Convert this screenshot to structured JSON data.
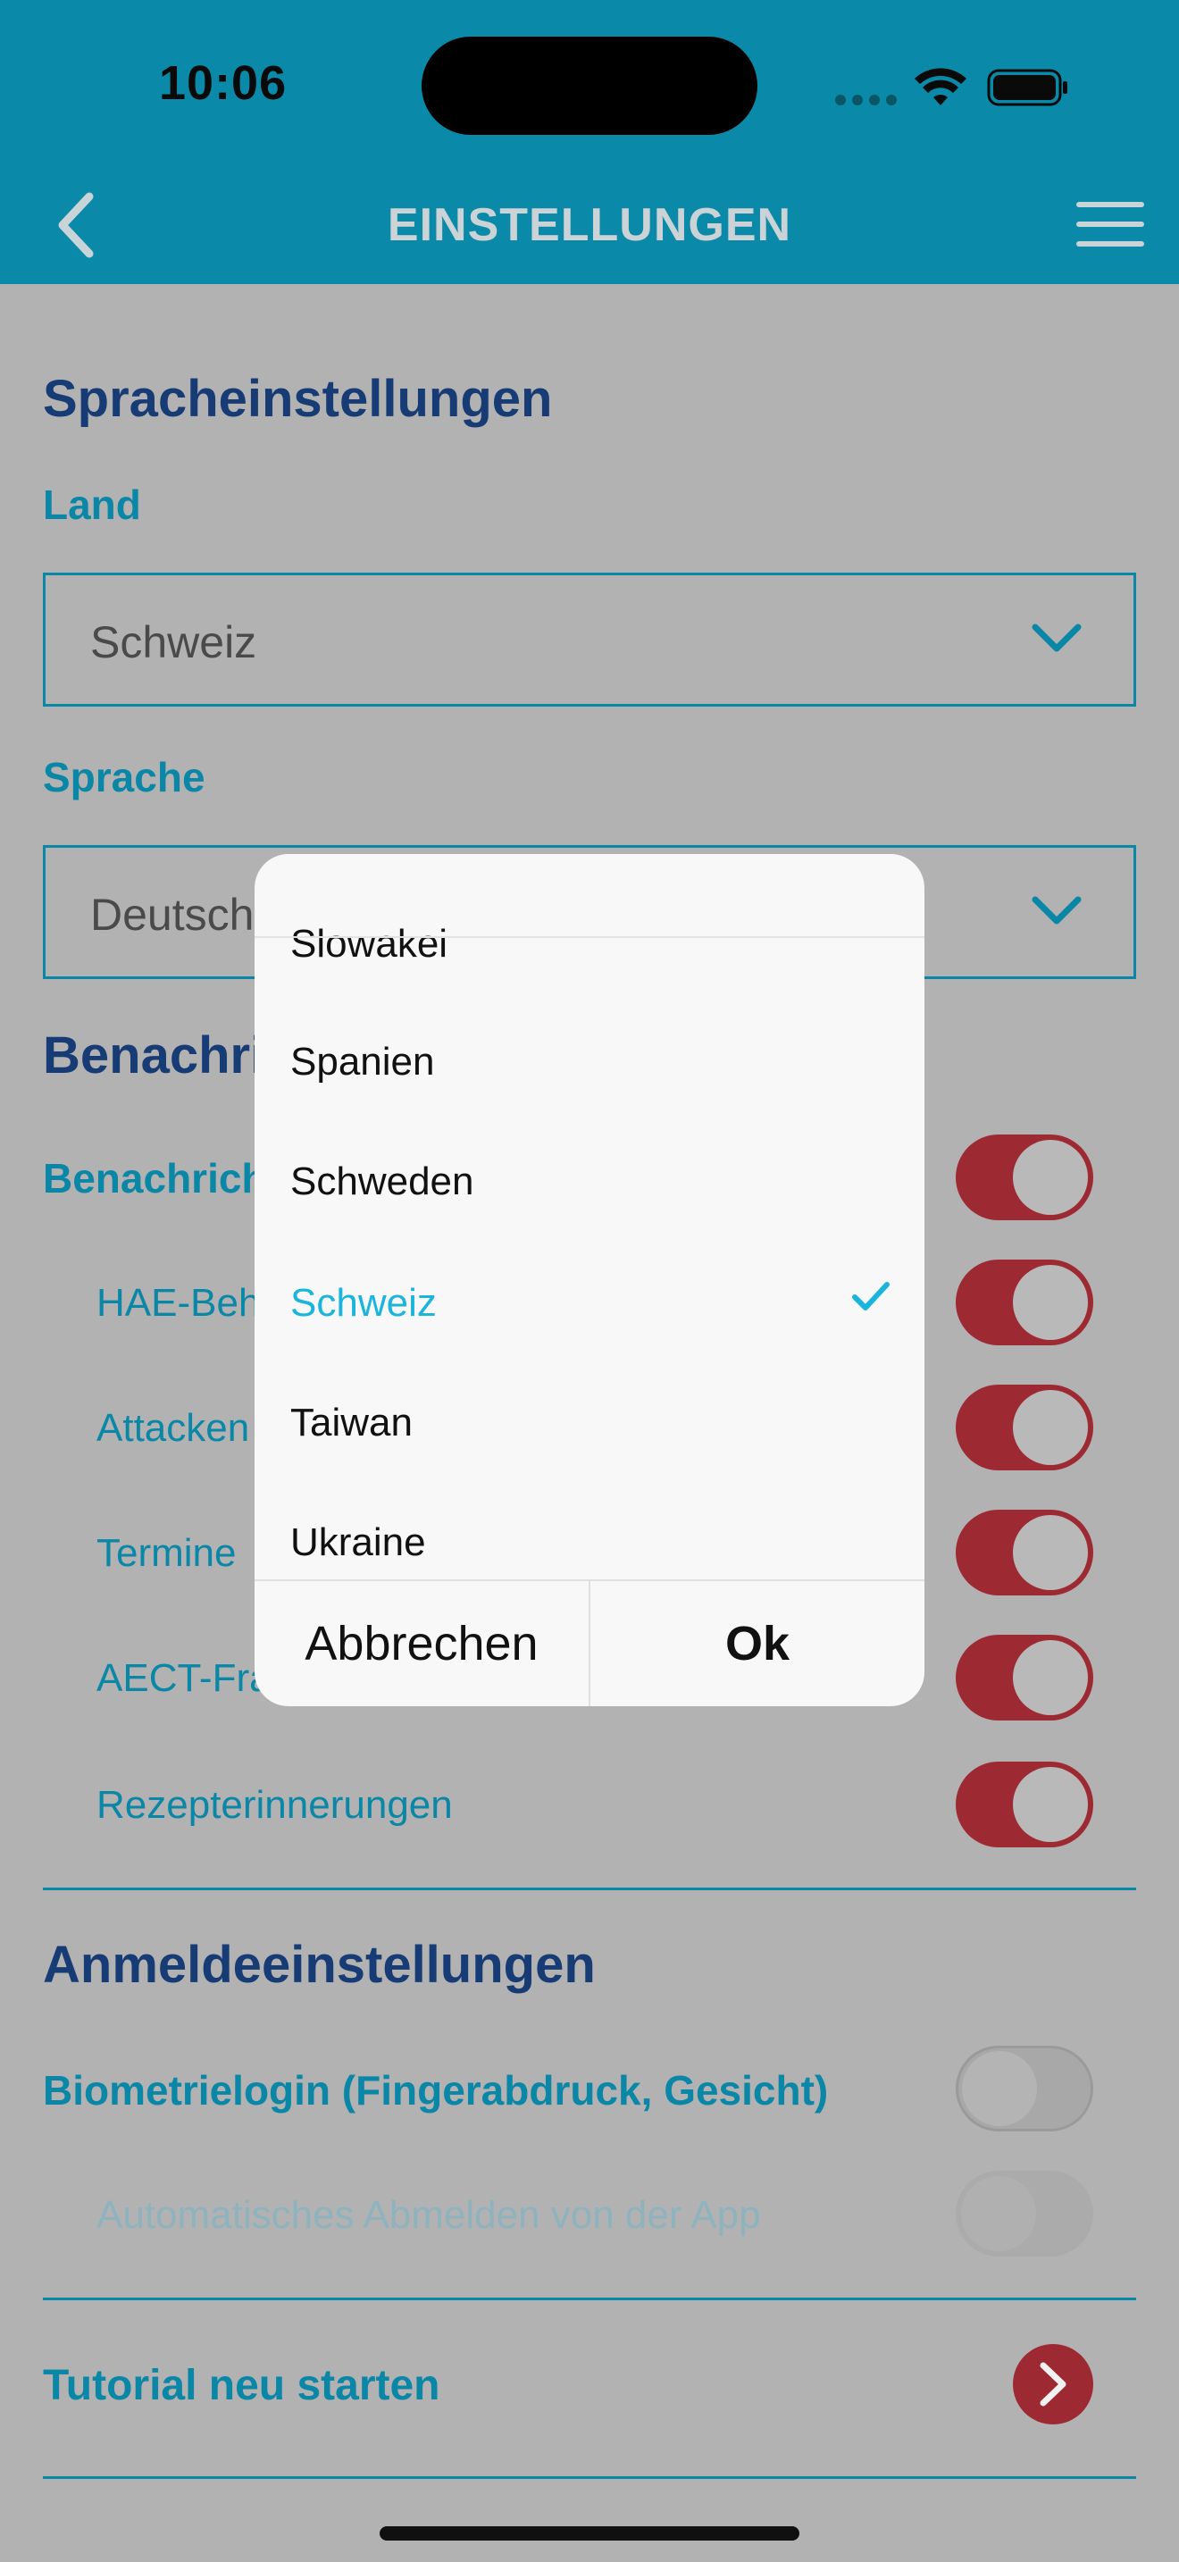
{
  "status_bar": {
    "time": "10:06"
  },
  "header": {
    "title": "EINSTELLUNGEN"
  },
  "language_settings": {
    "title": "Spracheinstellungen",
    "country_label": "Land",
    "country_value": "Schweiz",
    "language_label": "Sprache",
    "language_value": "Deutsch"
  },
  "notifications": {
    "title": "Benachrichtigungen",
    "main_label": "Benachrichtigungen",
    "items": [
      {
        "label": "HAE-Behandlungen",
        "on": true
      },
      {
        "label": "Attacken",
        "on": true
      },
      {
        "label": "Termine",
        "on": true
      },
      {
        "label": "AECT-Fragebogen",
        "on": true
      },
      {
        "label": "Rezepterinnerungen",
        "on": true
      }
    ]
  },
  "login_settings": {
    "title": "Anmeldeeinstellungen",
    "biometric_label": "Biometrielogin (Fingerabdruck, Gesicht)",
    "biometric_on": false,
    "auto_logout_label": "Automatisches Abmelden von der App",
    "auto_logout_on": false
  },
  "tutorial": {
    "label": "Tutorial neu starten"
  },
  "picker": {
    "items": [
      "Slowakei",
      "Spanien",
      "Schweden",
      "Schweiz",
      "Taiwan",
      "Ukraine"
    ],
    "selected": "Schweiz",
    "cancel_label": "Abbrechen",
    "ok_label": "Ok"
  },
  "colors": {
    "header_bg": "#0a8aa8",
    "accent": "#0a86a6",
    "title": "#173b74",
    "toggle_on": "#9d2a33",
    "selected_item": "#1ab4dc"
  }
}
